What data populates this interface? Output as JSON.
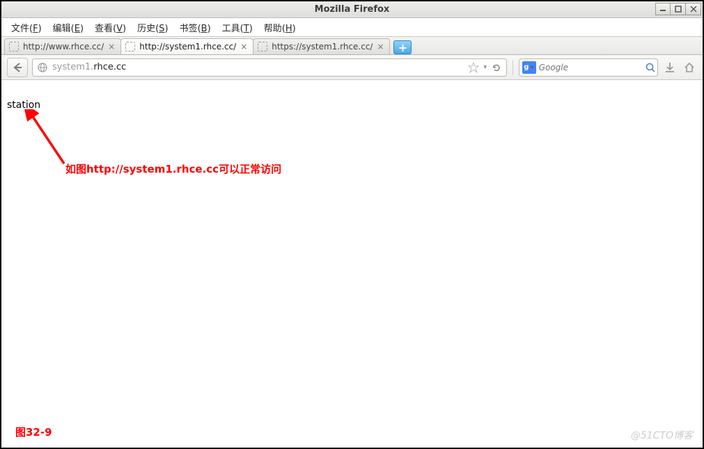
{
  "window": {
    "title": "Mozilla Firefox",
    "minimize_icon": "minimize-icon",
    "maximize_icon": "maximize-icon",
    "close_icon": "close-icon"
  },
  "menubar": {
    "items": [
      {
        "label": "文件",
        "hotkey": "F"
      },
      {
        "label": "编辑",
        "hotkey": "E"
      },
      {
        "label": "查看",
        "hotkey": "V"
      },
      {
        "label": "历史",
        "hotkey": "S"
      },
      {
        "label": "书签",
        "hotkey": "B"
      },
      {
        "label": "工具",
        "hotkey": "T"
      },
      {
        "label": "帮助",
        "hotkey": "H"
      }
    ]
  },
  "tabs": [
    {
      "label": "http://www.rhce.cc/",
      "active": false
    },
    {
      "label": "http://system1.rhce.cc/",
      "active": true
    },
    {
      "label": "https://system1.rhce.cc/",
      "active": false
    }
  ],
  "newtab_label": "+",
  "urlbar": {
    "prefix": "system1.",
    "main": "rhce.cc",
    "bookmark_icon": "star-icon",
    "refresh_icon": "refresh-icon"
  },
  "search": {
    "engine_label": "g",
    "placeholder": "Google",
    "search_icon": "search-icon"
  },
  "toolbar_icons": {
    "downloads": "download-icon",
    "home": "home-icon"
  },
  "page": {
    "body_text": "station"
  },
  "annotation": {
    "text": "如图http://system1.rhce.cc可以正常访问",
    "arrow_color": "#ff0000"
  },
  "figure_label": "图32-9",
  "watermark": "@51CTO博客"
}
